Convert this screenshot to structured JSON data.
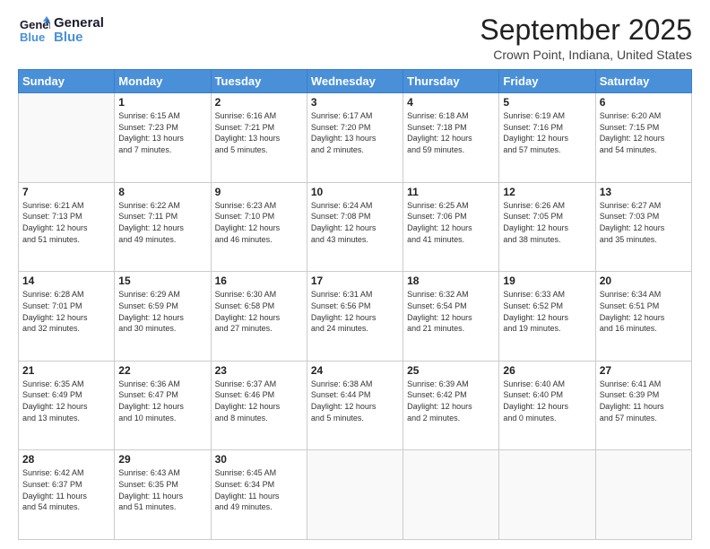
{
  "logo": {
    "line1": "General",
    "line2": "Blue"
  },
  "title": "September 2025",
  "subtitle": "Crown Point, Indiana, United States",
  "days_header": [
    "Sunday",
    "Monday",
    "Tuesday",
    "Wednesday",
    "Thursday",
    "Friday",
    "Saturday"
  ],
  "weeks": [
    [
      {
        "day": "",
        "info": ""
      },
      {
        "day": "1",
        "info": "Sunrise: 6:15 AM\nSunset: 7:23 PM\nDaylight: 13 hours\nand 7 minutes."
      },
      {
        "day": "2",
        "info": "Sunrise: 6:16 AM\nSunset: 7:21 PM\nDaylight: 13 hours\nand 5 minutes."
      },
      {
        "day": "3",
        "info": "Sunrise: 6:17 AM\nSunset: 7:20 PM\nDaylight: 13 hours\nand 2 minutes."
      },
      {
        "day": "4",
        "info": "Sunrise: 6:18 AM\nSunset: 7:18 PM\nDaylight: 12 hours\nand 59 minutes."
      },
      {
        "day": "5",
        "info": "Sunrise: 6:19 AM\nSunset: 7:16 PM\nDaylight: 12 hours\nand 57 minutes."
      },
      {
        "day": "6",
        "info": "Sunrise: 6:20 AM\nSunset: 7:15 PM\nDaylight: 12 hours\nand 54 minutes."
      }
    ],
    [
      {
        "day": "7",
        "info": "Sunrise: 6:21 AM\nSunset: 7:13 PM\nDaylight: 12 hours\nand 51 minutes."
      },
      {
        "day": "8",
        "info": "Sunrise: 6:22 AM\nSunset: 7:11 PM\nDaylight: 12 hours\nand 49 minutes."
      },
      {
        "day": "9",
        "info": "Sunrise: 6:23 AM\nSunset: 7:10 PM\nDaylight: 12 hours\nand 46 minutes."
      },
      {
        "day": "10",
        "info": "Sunrise: 6:24 AM\nSunset: 7:08 PM\nDaylight: 12 hours\nand 43 minutes."
      },
      {
        "day": "11",
        "info": "Sunrise: 6:25 AM\nSunset: 7:06 PM\nDaylight: 12 hours\nand 41 minutes."
      },
      {
        "day": "12",
        "info": "Sunrise: 6:26 AM\nSunset: 7:05 PM\nDaylight: 12 hours\nand 38 minutes."
      },
      {
        "day": "13",
        "info": "Sunrise: 6:27 AM\nSunset: 7:03 PM\nDaylight: 12 hours\nand 35 minutes."
      }
    ],
    [
      {
        "day": "14",
        "info": "Sunrise: 6:28 AM\nSunset: 7:01 PM\nDaylight: 12 hours\nand 32 minutes."
      },
      {
        "day": "15",
        "info": "Sunrise: 6:29 AM\nSunset: 6:59 PM\nDaylight: 12 hours\nand 30 minutes."
      },
      {
        "day": "16",
        "info": "Sunrise: 6:30 AM\nSunset: 6:58 PM\nDaylight: 12 hours\nand 27 minutes."
      },
      {
        "day": "17",
        "info": "Sunrise: 6:31 AM\nSunset: 6:56 PM\nDaylight: 12 hours\nand 24 minutes."
      },
      {
        "day": "18",
        "info": "Sunrise: 6:32 AM\nSunset: 6:54 PM\nDaylight: 12 hours\nand 21 minutes."
      },
      {
        "day": "19",
        "info": "Sunrise: 6:33 AM\nSunset: 6:52 PM\nDaylight: 12 hours\nand 19 minutes."
      },
      {
        "day": "20",
        "info": "Sunrise: 6:34 AM\nSunset: 6:51 PM\nDaylight: 12 hours\nand 16 minutes."
      }
    ],
    [
      {
        "day": "21",
        "info": "Sunrise: 6:35 AM\nSunset: 6:49 PM\nDaylight: 12 hours\nand 13 minutes."
      },
      {
        "day": "22",
        "info": "Sunrise: 6:36 AM\nSunset: 6:47 PM\nDaylight: 12 hours\nand 10 minutes."
      },
      {
        "day": "23",
        "info": "Sunrise: 6:37 AM\nSunset: 6:46 PM\nDaylight: 12 hours\nand 8 minutes."
      },
      {
        "day": "24",
        "info": "Sunrise: 6:38 AM\nSunset: 6:44 PM\nDaylight: 12 hours\nand 5 minutes."
      },
      {
        "day": "25",
        "info": "Sunrise: 6:39 AM\nSunset: 6:42 PM\nDaylight: 12 hours\nand 2 minutes."
      },
      {
        "day": "26",
        "info": "Sunrise: 6:40 AM\nSunset: 6:40 PM\nDaylight: 12 hours\nand 0 minutes."
      },
      {
        "day": "27",
        "info": "Sunrise: 6:41 AM\nSunset: 6:39 PM\nDaylight: 11 hours\nand 57 minutes."
      }
    ],
    [
      {
        "day": "28",
        "info": "Sunrise: 6:42 AM\nSunset: 6:37 PM\nDaylight: 11 hours\nand 54 minutes."
      },
      {
        "day": "29",
        "info": "Sunrise: 6:43 AM\nSunset: 6:35 PM\nDaylight: 11 hours\nand 51 minutes."
      },
      {
        "day": "30",
        "info": "Sunrise: 6:45 AM\nSunset: 6:34 PM\nDaylight: 11 hours\nand 49 minutes."
      },
      {
        "day": "",
        "info": ""
      },
      {
        "day": "",
        "info": ""
      },
      {
        "day": "",
        "info": ""
      },
      {
        "day": "",
        "info": ""
      }
    ]
  ]
}
